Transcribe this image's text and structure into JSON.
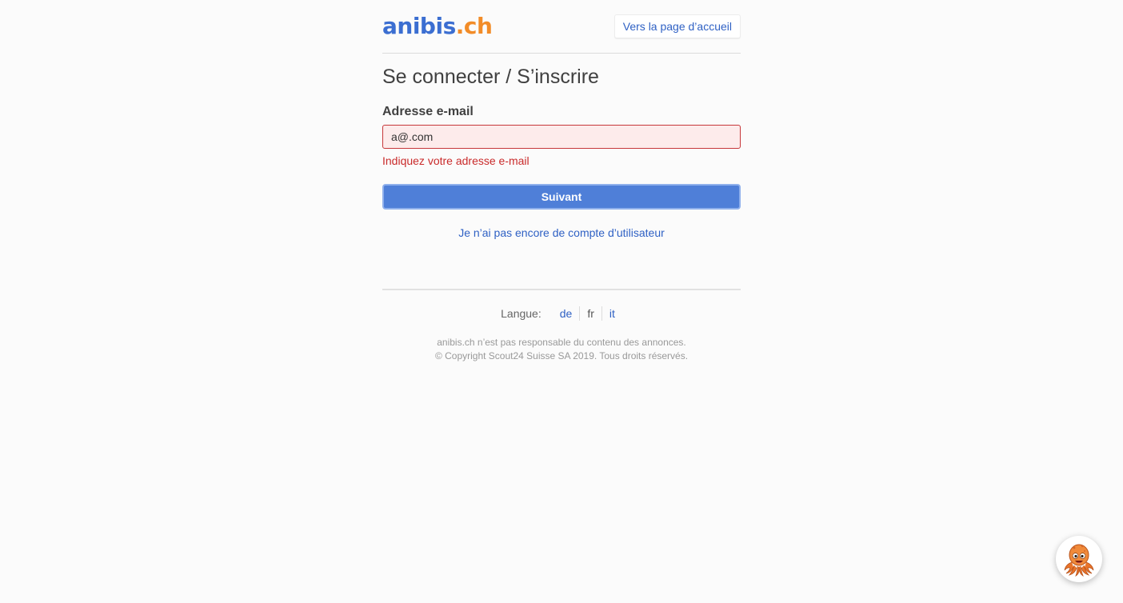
{
  "header": {
    "logo_part1": "anibis",
    "logo_part2": ".ch",
    "home_link": "Vers la page d’accueil"
  },
  "title": "Se connecter / S’inscrire",
  "form": {
    "email_label": "Adresse e-mail",
    "email_value": "a@.com",
    "error_message": "Indiquez votre adresse e-mail",
    "next_button": "Suivant",
    "no_account_link": "Je n’ai pas encore de compte d’utilisateur"
  },
  "language": {
    "label": "Langue:",
    "options": [
      "de",
      "fr",
      "it"
    ],
    "selected": "fr"
  },
  "footer": {
    "disclaimer": "anibis.ch n’est pas responsable du contenu des annonces.",
    "copyright": "© Copyright Scout24 Suisse SA 2019. Tous droits réservés."
  },
  "chat_widget": {
    "icon": "octopus-icon"
  },
  "colors": {
    "brand_blue": "#3b6ed1",
    "brand_orange": "#f28c28",
    "error_red": "#c92a2a",
    "button_blue": "#4f7fd8"
  }
}
